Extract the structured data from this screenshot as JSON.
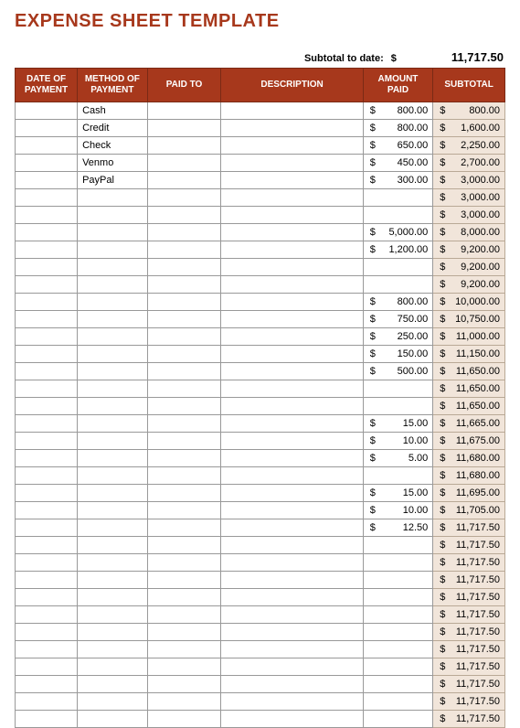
{
  "title": "EXPENSE SHEET TEMPLATE",
  "subtotal_to_date": {
    "label": "Subtotal to date:",
    "currency": "$",
    "value": "11,717.50"
  },
  "columns": {
    "date": "DATE OF PAYMENT",
    "method": "METHOD OF PAYMENT",
    "paid_to": "PAID TO",
    "description": "DESCRIPTION",
    "amount": "AMOUNT PAID",
    "subtotal": "SUBTOTAL"
  },
  "rows": [
    {
      "date": "",
      "method": "Cash",
      "paid_to": "",
      "description": "",
      "amount": "800.00",
      "subtotal": "800.00"
    },
    {
      "date": "",
      "method": "Credit",
      "paid_to": "",
      "description": "",
      "amount": "800.00",
      "subtotal": "1,600.00"
    },
    {
      "date": "",
      "method": "Check",
      "paid_to": "",
      "description": "",
      "amount": "650.00",
      "subtotal": "2,250.00"
    },
    {
      "date": "",
      "method": "Venmo",
      "paid_to": "",
      "description": "",
      "amount": "450.00",
      "subtotal": "2,700.00"
    },
    {
      "date": "",
      "method": "PayPal",
      "paid_to": "",
      "description": "",
      "amount": "300.00",
      "subtotal": "3,000.00"
    },
    {
      "date": "",
      "method": "",
      "paid_to": "",
      "description": "",
      "amount": "",
      "subtotal": "3,000.00"
    },
    {
      "date": "",
      "method": "",
      "paid_to": "",
      "description": "",
      "amount": "",
      "subtotal": "3,000.00"
    },
    {
      "date": "",
      "method": "",
      "paid_to": "",
      "description": "",
      "amount": "5,000.00",
      "subtotal": "8,000.00"
    },
    {
      "date": "",
      "method": "",
      "paid_to": "",
      "description": "",
      "amount": "1,200.00",
      "subtotal": "9,200.00"
    },
    {
      "date": "",
      "method": "",
      "paid_to": "",
      "description": "",
      "amount": "",
      "subtotal": "9,200.00"
    },
    {
      "date": "",
      "method": "",
      "paid_to": "",
      "description": "",
      "amount": "",
      "subtotal": "9,200.00"
    },
    {
      "date": "",
      "method": "",
      "paid_to": "",
      "description": "",
      "amount": "800.00",
      "subtotal": "10,000.00"
    },
    {
      "date": "",
      "method": "",
      "paid_to": "",
      "description": "",
      "amount": "750.00",
      "subtotal": "10,750.00"
    },
    {
      "date": "",
      "method": "",
      "paid_to": "",
      "description": "",
      "amount": "250.00",
      "subtotal": "11,000.00"
    },
    {
      "date": "",
      "method": "",
      "paid_to": "",
      "description": "",
      "amount": "150.00",
      "subtotal": "11,150.00"
    },
    {
      "date": "",
      "method": "",
      "paid_to": "",
      "description": "",
      "amount": "500.00",
      "subtotal": "11,650.00"
    },
    {
      "date": "",
      "method": "",
      "paid_to": "",
      "description": "",
      "amount": "",
      "subtotal": "11,650.00"
    },
    {
      "date": "",
      "method": "",
      "paid_to": "",
      "description": "",
      "amount": "",
      "subtotal": "11,650.00"
    },
    {
      "date": "",
      "method": "",
      "paid_to": "",
      "description": "",
      "amount": "15.00",
      "subtotal": "11,665.00"
    },
    {
      "date": "",
      "method": "",
      "paid_to": "",
      "description": "",
      "amount": "10.00",
      "subtotal": "11,675.00"
    },
    {
      "date": "",
      "method": "",
      "paid_to": "",
      "description": "",
      "amount": "5.00",
      "subtotal": "11,680.00"
    },
    {
      "date": "",
      "method": "",
      "paid_to": "",
      "description": "",
      "amount": "",
      "subtotal": "11,680.00"
    },
    {
      "date": "",
      "method": "",
      "paid_to": "",
      "description": "",
      "amount": "15.00",
      "subtotal": "11,695.00"
    },
    {
      "date": "",
      "method": "",
      "paid_to": "",
      "description": "",
      "amount": "10.00",
      "subtotal": "11,705.00"
    },
    {
      "date": "",
      "method": "",
      "paid_to": "",
      "description": "",
      "amount": "12.50",
      "subtotal": "11,717.50"
    },
    {
      "date": "",
      "method": "",
      "paid_to": "",
      "description": "",
      "amount": "",
      "subtotal": "11,717.50"
    },
    {
      "date": "",
      "method": "",
      "paid_to": "",
      "description": "",
      "amount": "",
      "subtotal": "11,717.50"
    },
    {
      "date": "",
      "method": "",
      "paid_to": "",
      "description": "",
      "amount": "",
      "subtotal": "11,717.50"
    },
    {
      "date": "",
      "method": "",
      "paid_to": "",
      "description": "",
      "amount": "",
      "subtotal": "11,717.50"
    },
    {
      "date": "",
      "method": "",
      "paid_to": "",
      "description": "",
      "amount": "",
      "subtotal": "11,717.50"
    },
    {
      "date": "",
      "method": "",
      "paid_to": "",
      "description": "",
      "amount": "",
      "subtotal": "11,717.50"
    },
    {
      "date": "",
      "method": "",
      "paid_to": "",
      "description": "",
      "amount": "",
      "subtotal": "11,717.50"
    },
    {
      "date": "",
      "method": "",
      "paid_to": "",
      "description": "",
      "amount": "",
      "subtotal": "11,717.50"
    },
    {
      "date": "",
      "method": "",
      "paid_to": "",
      "description": "",
      "amount": "",
      "subtotal": "11,717.50"
    },
    {
      "date": "",
      "method": "",
      "paid_to": "",
      "description": "",
      "amount": "",
      "subtotal": "11,717.50"
    },
    {
      "date": "",
      "method": "",
      "paid_to": "",
      "description": "",
      "amount": "",
      "subtotal": "11,717.50"
    }
  ]
}
